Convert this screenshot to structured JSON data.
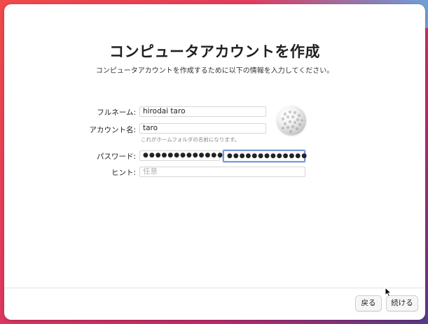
{
  "window": {
    "title": "コンピュータアカウントを作成",
    "subtitle": "コンピュータアカウントを作成するために以下の情報を入力してください。"
  },
  "form": {
    "full_name_label": "フルネーム:",
    "full_name_value": "hirodai taro",
    "account_name_label": "アカウント名:",
    "account_name_value": "taro",
    "account_name_hint": "これがホームフォルダの名前になります。",
    "password_label": "パスワード:",
    "password_value": "●●●●●●●●●●●●●",
    "password_verify_value": "●●●●●●●●●●●●●",
    "hint_label": "ヒント:",
    "hint_placeholder": "任意"
  },
  "avatar": {
    "icon": "golf-ball-icon"
  },
  "buttons": {
    "back_label": "戻る",
    "continue_label": "続ける"
  },
  "colors": {
    "focus_ring": "#7b98dd",
    "window_bg": "#ffffff"
  }
}
